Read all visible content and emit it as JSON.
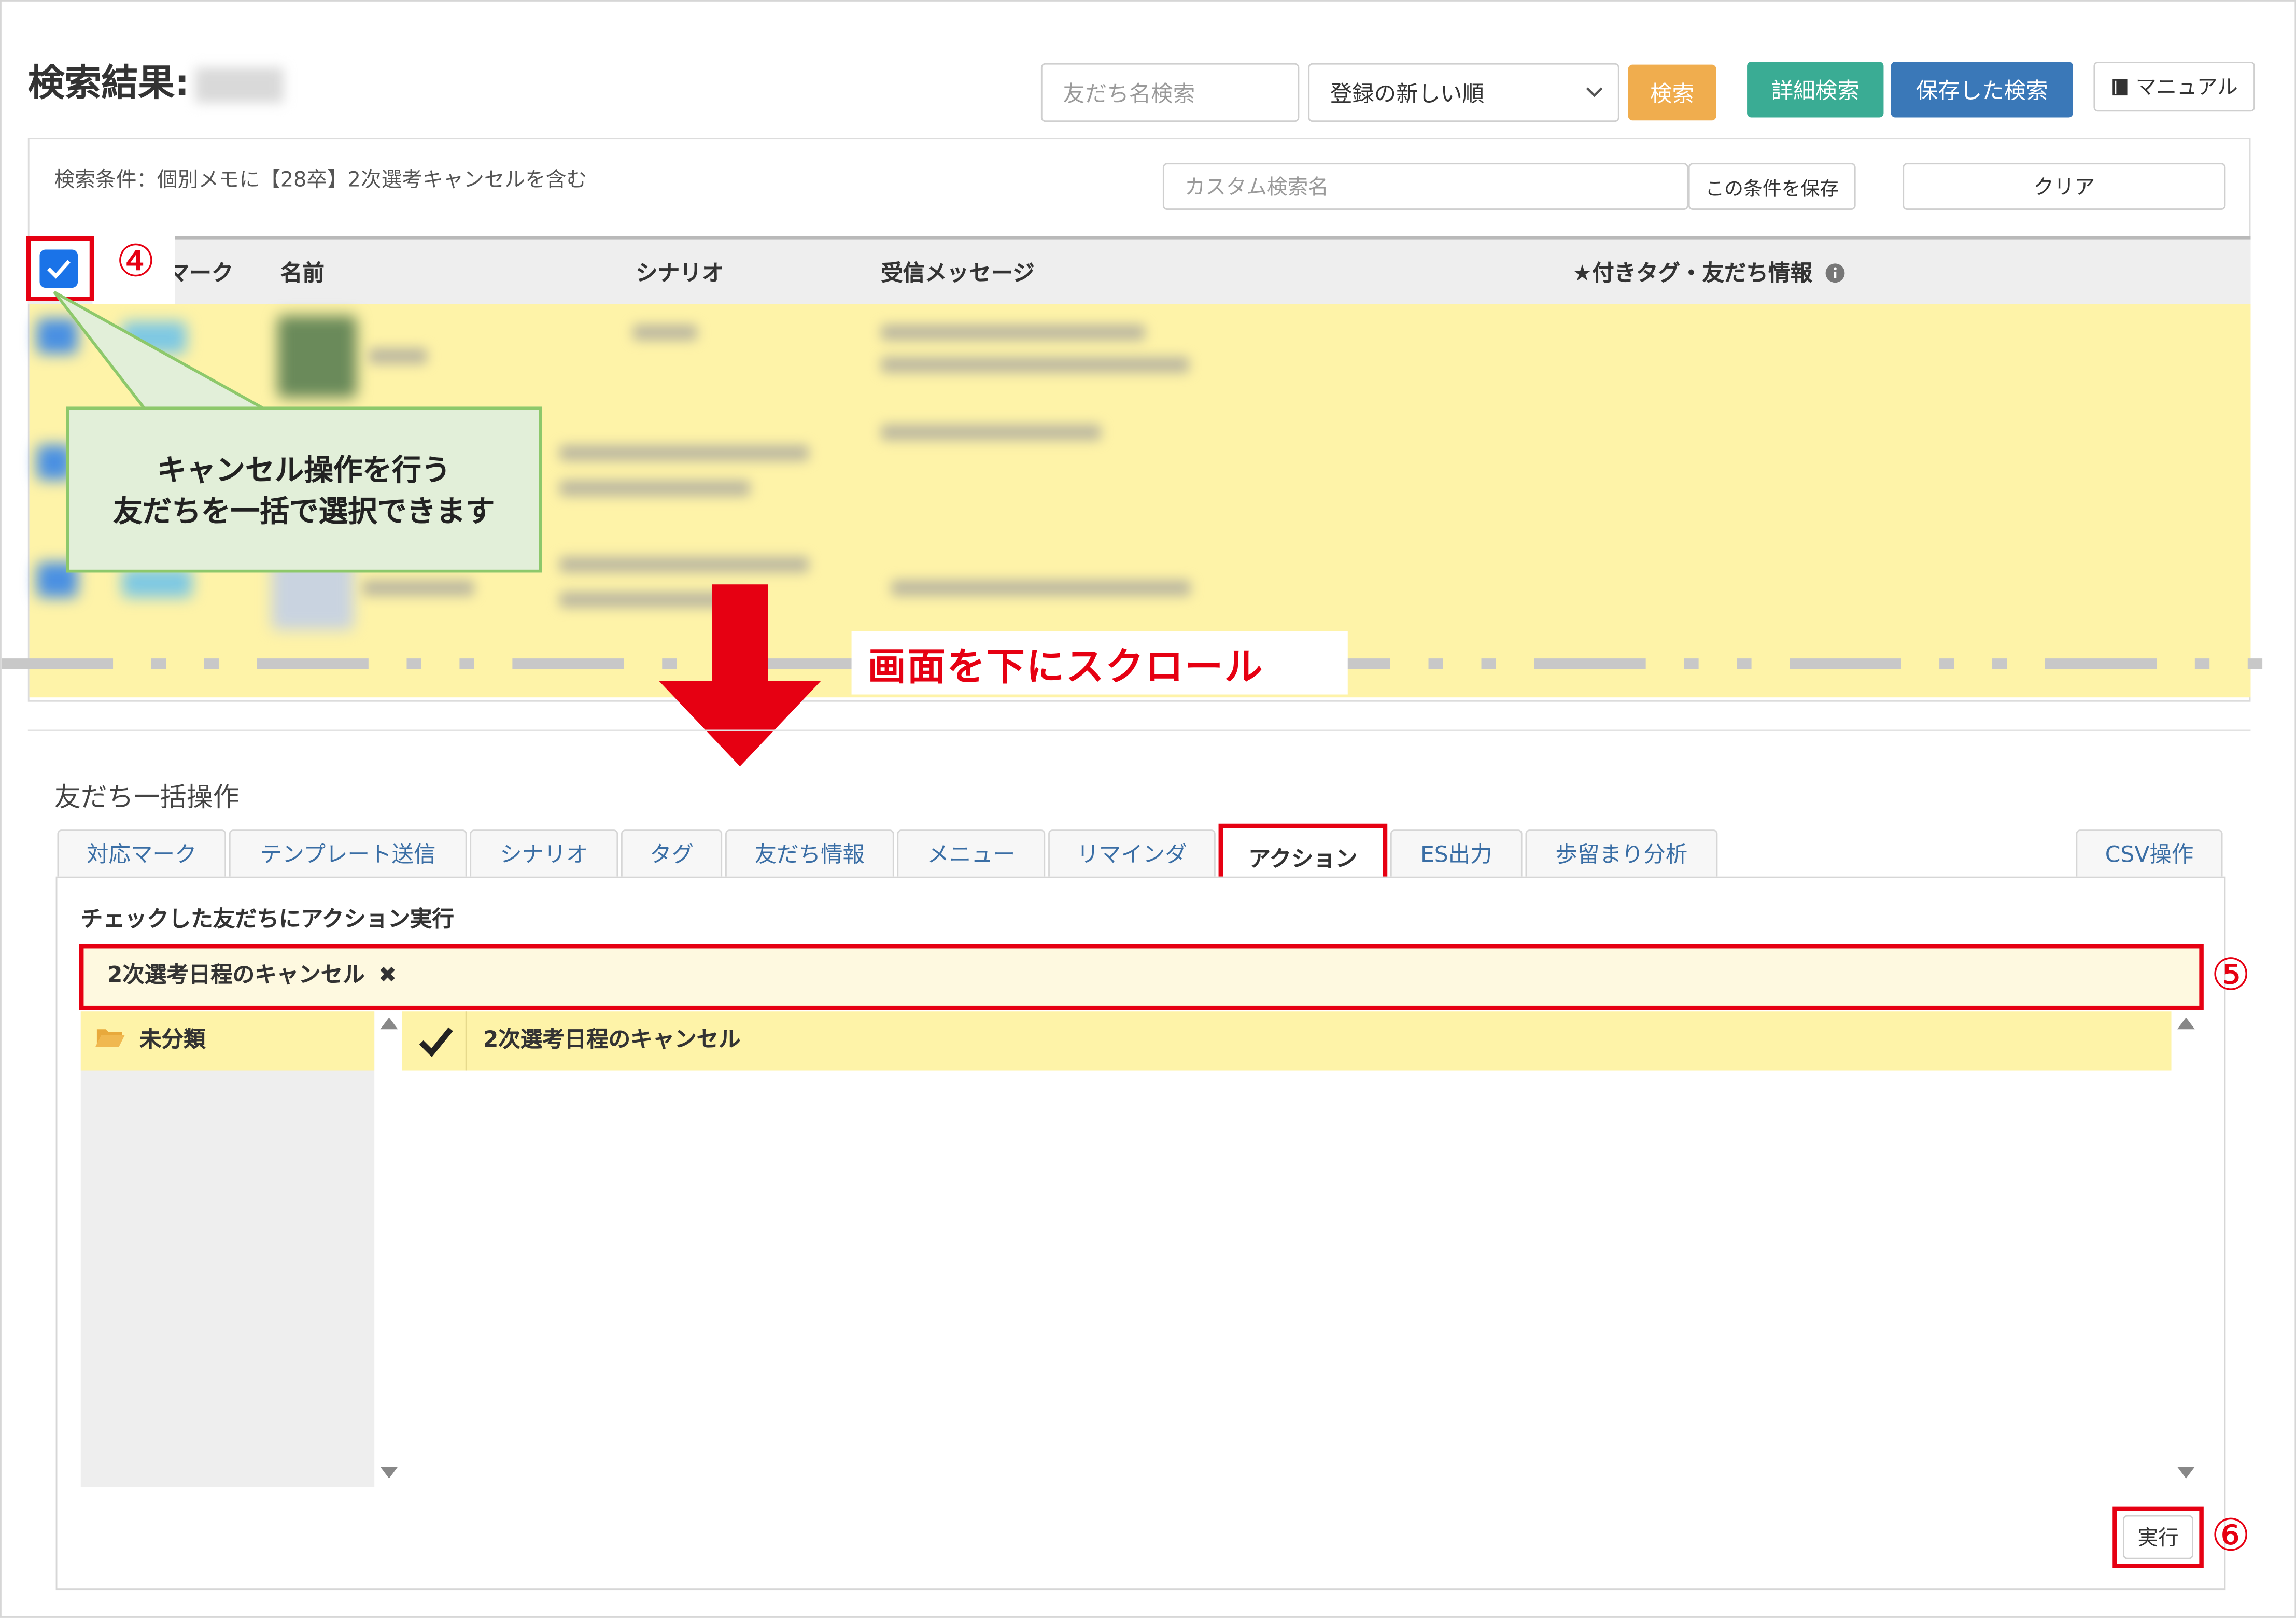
{
  "header": {
    "title": "検索結果:",
    "friend_search_placeholder": "友だち名検索",
    "sort_select": "登録の新しい順",
    "search_button": "検索",
    "detail_search_button": "詳細検索",
    "saved_search_button": "保存した検索",
    "manual_button": "マニュアル"
  },
  "conditions": {
    "text": "検索条件：個別メモに【28卒】2次選考キャンセルを含む",
    "custom_name_placeholder": "カスタム検索名",
    "save_condition_button": "この条件を保存",
    "clear_button": "クリア"
  },
  "table": {
    "columns": [
      "マーク",
      "名前",
      "シナリオ",
      "受信メッセージ",
      "★付きタグ・友だち情報"
    ]
  },
  "annotations": {
    "step4": "④",
    "step5": "⑤",
    "step6": "⑥",
    "callout_line1": "キャンセル操作を行う",
    "callout_line2": "友だちを一括で選択できます",
    "scroll_label": "画面を下にスクロール"
  },
  "bulk": {
    "section_title": "友だち一括操作",
    "tabs": [
      "対応マーク",
      "テンプレート送信",
      "シナリオ",
      "タグ",
      "友だち情報",
      "メニュー",
      "リマインダ",
      "アクション",
      "ES出力",
      "歩留まり分析",
      "CSV操作"
    ],
    "active_tab": "アクション",
    "subheading": "チェックした友だちにアクション実行",
    "selected_action": "2次選考日程のキャンセル",
    "remove_glyph": "✖",
    "folder": "未分類",
    "action_item": "2次選考日程のキャンセル",
    "execute_button": "実行"
  },
  "colors": {
    "highlight_red": "#e60012",
    "row_yellow": "#fef3a8",
    "orange": "#f0ad4e",
    "teal": "#3aac94",
    "blue": "#3a78b8"
  }
}
